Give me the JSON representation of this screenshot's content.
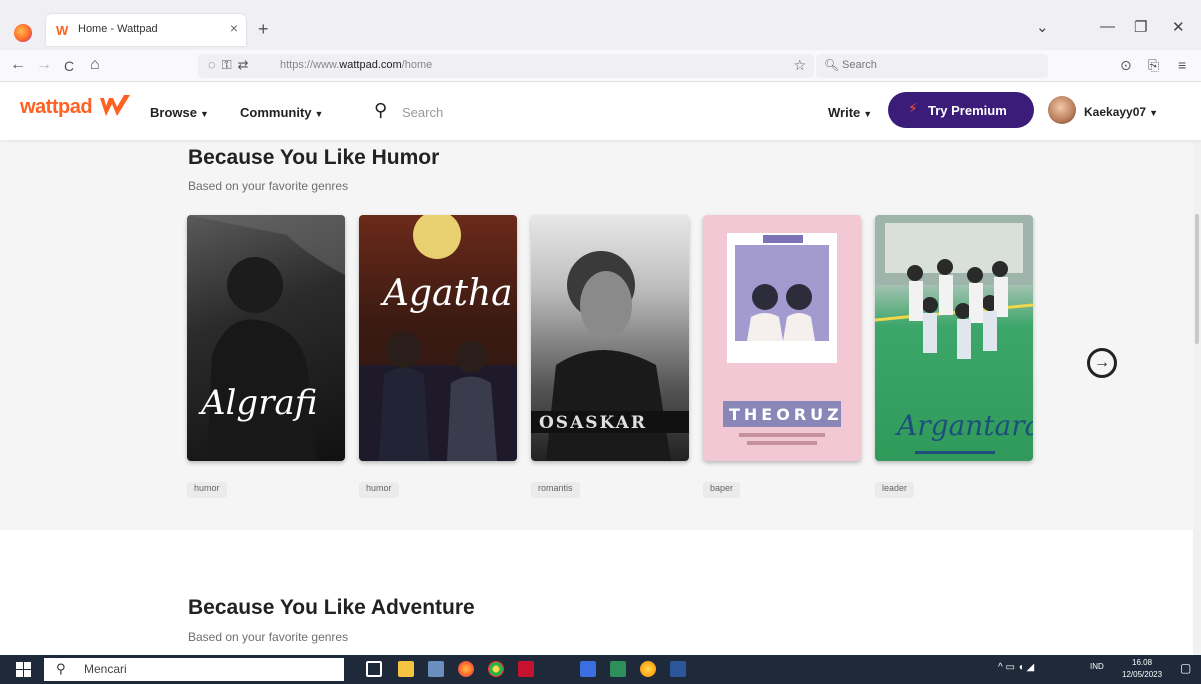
{
  "browser": {
    "tab_title": "Home - Wattpad",
    "tab_close": "×",
    "new_tab": "+",
    "url_prefix": "https://www.",
    "url_domain": "wattpad.com",
    "url_path": "/home",
    "search_placeholder": "Search",
    "back": "←",
    "forward": "→",
    "reload": "C",
    "home": "⌂",
    "star": "☆",
    "window_controls": [
      "⌄",
      "—",
      "❐",
      "✕"
    ]
  },
  "header": {
    "logo": "wattpad",
    "browse": "Browse",
    "community": "Community",
    "search_placeholder": "Search",
    "write": "Write",
    "premium": "Try Premium",
    "username": "Kaekayy07"
  },
  "sections": [
    {
      "title": "Because You Like Humor",
      "subtitle": "Based on your favorite genres",
      "books": [
        {
          "cover_text": "Algrafi",
          "tag": "humor"
        },
        {
          "cover_text": "Agatha",
          "tag": "humor"
        },
        {
          "cover_text": "OSASKAR",
          "tag": "romantis"
        },
        {
          "cover_text": "THEORUZ",
          "tag": "baper"
        },
        {
          "cover_text": "Argantara",
          "tag": "leader"
        }
      ]
    },
    {
      "title": "Because You Like Adventure",
      "subtitle": "Based on your favorite genres"
    }
  ],
  "taskbar": {
    "search_placeholder": "Mencari",
    "tray_lang": "IND",
    "time": "16.08",
    "date": "12/05/2023"
  },
  "colors": {
    "brand_orange": "#ff6122",
    "premium_purple": "#3b1c79"
  }
}
